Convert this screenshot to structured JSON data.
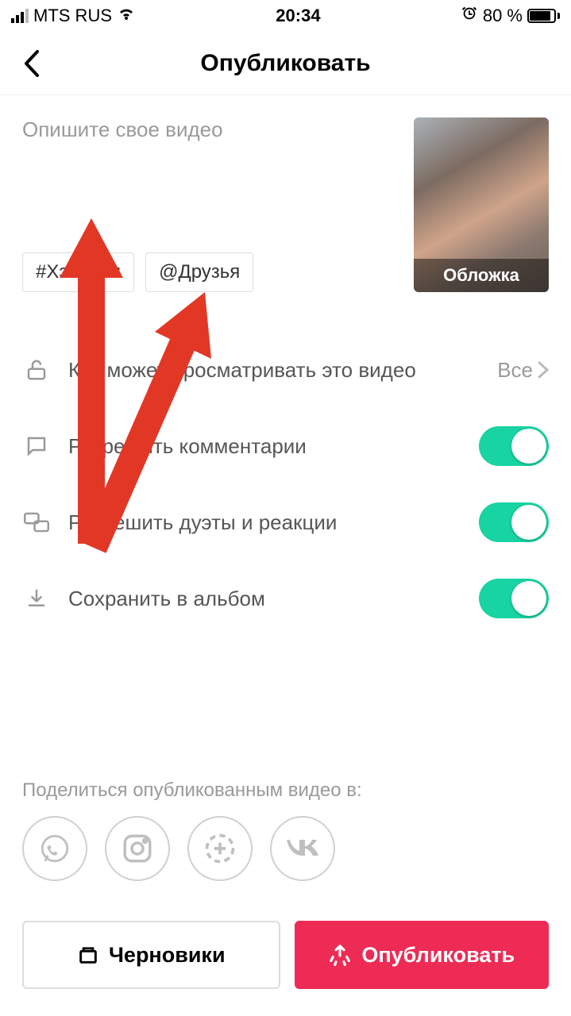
{
  "status": {
    "carrier": "MTS RUS",
    "time": "20:34",
    "battery_text": "80 %"
  },
  "header": {
    "title": "Опубликовать"
  },
  "compose": {
    "placeholder": "Опишите свое видео",
    "hashtags_label": "#Хэштеги",
    "friends_label": "@Друзья",
    "thumb_label": "Обложка"
  },
  "settings": {
    "visibility_label": "Кто может просматривать это видео",
    "visibility_value": "Все",
    "comments_label": "Разрешить комментарии",
    "duets_label": "Разрешить дуэты и реакции",
    "save_label": "Сохранить в альбом"
  },
  "share": {
    "title": "Поделиться опубликованным видео в:"
  },
  "buttons": {
    "drafts": "Черновики",
    "publish": "Опубликовать"
  }
}
